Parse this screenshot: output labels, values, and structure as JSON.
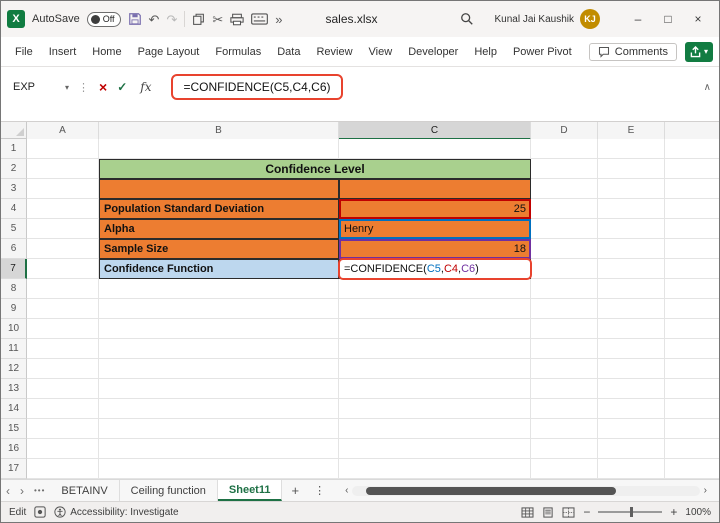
{
  "colors": {
    "excel_green": "#107c41",
    "accent_green": "#1e7145",
    "table_green": "#a9d08e",
    "table_orange": "#ed7d31",
    "table_blue": "#bdd7ee",
    "annotation_red": "#e8432e",
    "ref_blue": "#0070c0",
    "ref_red": "#c00000",
    "ref_purple": "#7030a0",
    "avatar_gold": "#c18c00"
  },
  "titlebar": {
    "autosave_label": "AutoSave",
    "autosave_state": "Off",
    "undo_glyph": "↶",
    "redo_glyph": "↷",
    "cut_glyph": "✂",
    "more_chevron": "»",
    "filename": "sales.xlsx",
    "user_name": "Kunal Jai Kaushik",
    "user_initials": "KJ",
    "minimize_glyph": "–",
    "maximize_glyph": "□",
    "close_glyph": "×"
  },
  "ribbon": {
    "tabs": [
      "File",
      "Insert",
      "Home",
      "Page Layout",
      "Formulas",
      "Data",
      "Review",
      "View",
      "Developer",
      "Help",
      "Power Pivot"
    ],
    "comments_label": "Comments",
    "share_caret": "▾"
  },
  "formula_bar": {
    "name_box_value": "EXP",
    "name_box_caret": "▾",
    "menu_dots": "⋮",
    "cancel_glyph": "×",
    "enter_glyph": "✓",
    "fx_label": "fx",
    "formula": "=CONFIDENCE(C5,C4,C6)",
    "collapse_glyph": "∧"
  },
  "grid": {
    "column_headers": [
      "A",
      "B",
      "C",
      "D",
      "E",
      ""
    ],
    "visible_rows": 17,
    "selected_column": "C",
    "selected_row": 7,
    "cells": [
      {
        "row": 2,
        "col": "B",
        "merge": 2,
        "text": "Confidence Level",
        "cls": "t green bold center"
      },
      {
        "row": 3,
        "col": "B",
        "text": "",
        "cls": "t orange"
      },
      {
        "row": 3,
        "col": "C",
        "text": "",
        "cls": "t orange"
      },
      {
        "row": 4,
        "col": "B",
        "text": "Population Standard Deviation",
        "cls": "t orange bold"
      },
      {
        "row": 4,
        "col": "C",
        "text": "25",
        "cls": "t orange num",
        "ref_color": "ref_red"
      },
      {
        "row": 5,
        "col": "B",
        "text": "Alpha",
        "cls": "t orange bold"
      },
      {
        "row": 5,
        "col": "C",
        "text": "Henry",
        "cls": "t orange",
        "ref_color": "ref_blue"
      },
      {
        "row": 6,
        "col": "B",
        "text": "Sample Size",
        "cls": "t orange bold"
      },
      {
        "row": 6,
        "col": "C",
        "text": "18",
        "cls": "t orange num",
        "ref_color": "ref_purple"
      },
      {
        "row": 7,
        "col": "B",
        "text": "Confidence Function",
        "cls": "t blue bold"
      },
      {
        "row": 7,
        "col": "C",
        "cls": "t white",
        "annotated": true,
        "parts": [
          {
            "text": "=CONFIDENCE(",
            "color": "#111111"
          },
          {
            "text": "C5",
            "color": "#0070c0"
          },
          {
            "text": ",",
            "color": "#111111"
          },
          {
            "text": "C4",
            "color": "#c00000"
          },
          {
            "text": ",",
            "color": "#111111"
          },
          {
            "text": "C6",
            "color": "#7030a0"
          },
          {
            "text": ")",
            "color": "#111111"
          }
        ]
      }
    ]
  },
  "sheet_tabs": {
    "nav_left": "‹",
    "nav_right": "›",
    "overflow_dots": "•••",
    "tabs": [
      "BETAINV",
      "Ceiling function",
      "Sheet11"
    ],
    "active_tab": "Sheet11",
    "add_glyph": "+",
    "menu_dots": "⋮"
  },
  "status_bar": {
    "mode": "Edit",
    "accessibility_text": "Accessibility: Investigate",
    "zoom_out_glyph": "−",
    "zoom_in_glyph": "+",
    "zoom_level": "100%"
  }
}
